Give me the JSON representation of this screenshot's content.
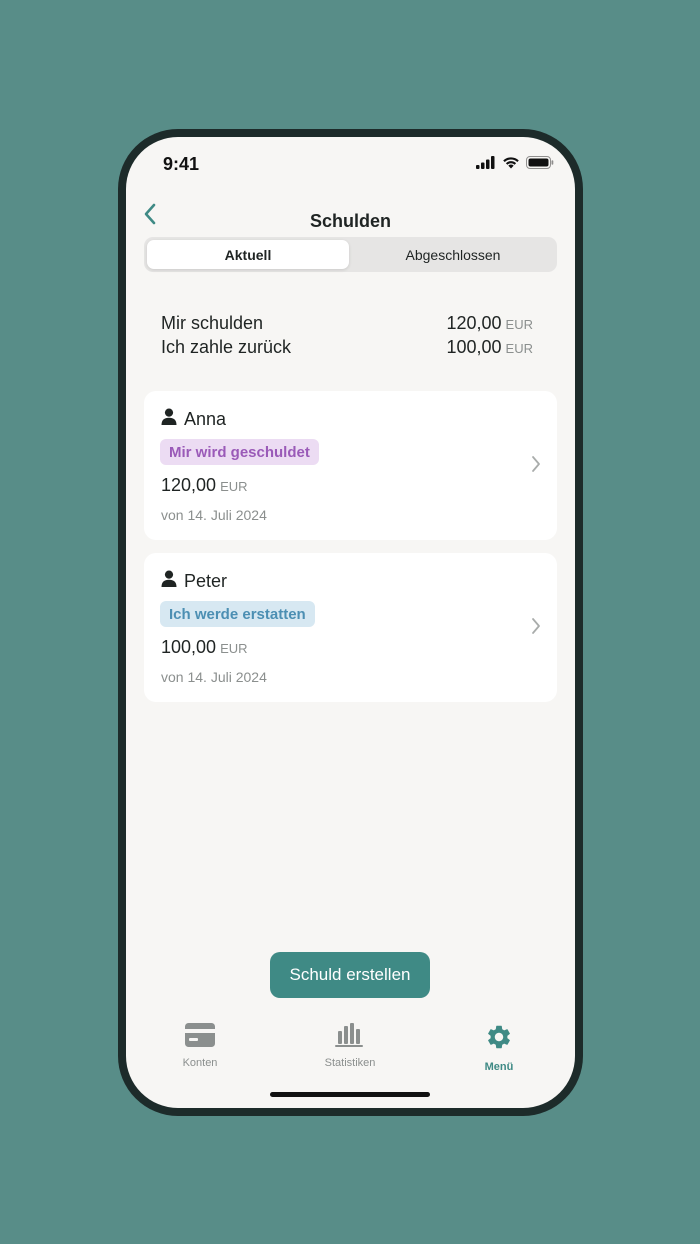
{
  "status_bar": {
    "time": "9:41"
  },
  "nav": {
    "title": "Schulden"
  },
  "segments": [
    {
      "label": "Aktuell",
      "selected": true
    },
    {
      "label": "Abgeschlossen",
      "selected": false
    }
  ],
  "summary": [
    {
      "label": "Mir schulden",
      "amount": "120,00",
      "currency": "EUR"
    },
    {
      "label": "Ich zahle zurück",
      "amount": "100,00",
      "currency": "EUR"
    }
  ],
  "debts": [
    {
      "name": "Anna",
      "badge": "Mir wird geschuldet",
      "amount": "120,00",
      "currency": "EUR",
      "date": "von 14. Juli 2024",
      "badge_color": "#9a5ab8"
    },
    {
      "name": "Peter",
      "badge": "Ich werde erstatten",
      "amount": "100,00",
      "currency": "EUR",
      "date": "von 14. Juli 2024",
      "badge_color": "#4c8fb3"
    }
  ],
  "create_button": {
    "label": "Schuld erstellen"
  },
  "tabbar": [
    {
      "label": "Konten",
      "icon": "card-icon",
      "active": false
    },
    {
      "label": "Statistiken",
      "icon": "bar-chart-icon",
      "active": false
    },
    {
      "label": "Menü",
      "icon": "gear-icon",
      "active": true
    }
  ],
  "colors": {
    "background": "#588d88",
    "accent": "#3f8a85",
    "phone_frame": "#1d2b2a",
    "screen": "#f7f6f4"
  }
}
